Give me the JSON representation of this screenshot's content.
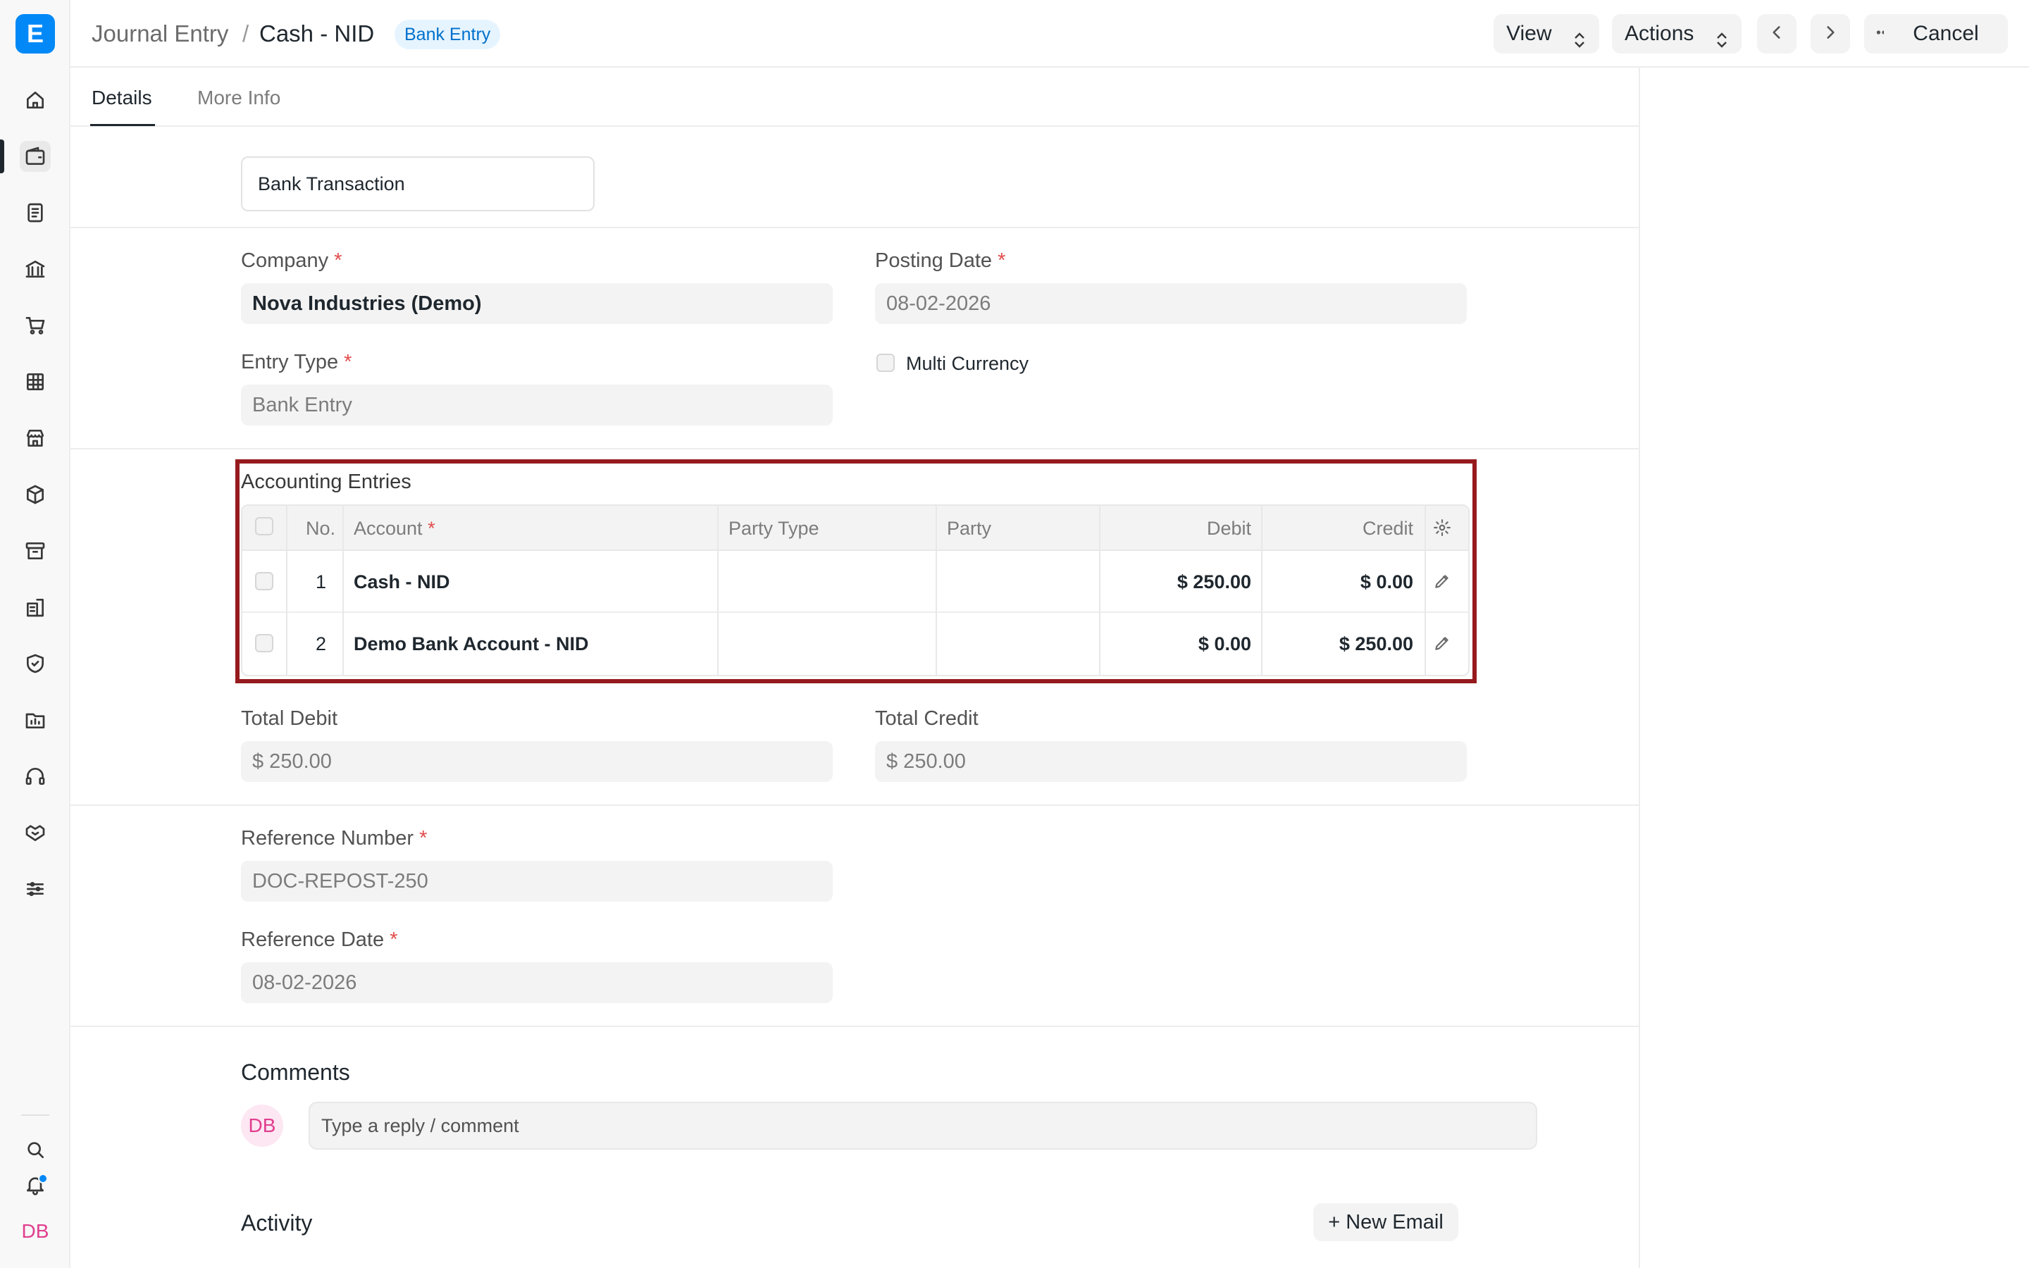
{
  "app": {
    "logo_letter": "E"
  },
  "sidebar": {
    "icons": [
      "home-icon",
      "wallet-icon",
      "document-icon",
      "bank-icon",
      "cart-icon",
      "table-icon",
      "store-icon",
      "box-icon",
      "archive-icon",
      "building-icon",
      "shield-icon",
      "folder-chart-icon",
      "headset-icon",
      "handshake-icon",
      "sliders-icon"
    ],
    "bottom_icons": [
      "search-icon",
      "bell-icon"
    ],
    "user_initials": "DB"
  },
  "header": {
    "breadcrumb_parent": "Journal Entry",
    "breadcrumb_sep": "/",
    "title": "Cash - NID",
    "status_badge": "Bank Entry",
    "view_label": "View",
    "actions_label": "Actions",
    "cancel_label": "Cancel"
  },
  "tabs": [
    {
      "label": "Details",
      "active": true
    },
    {
      "label": "More Info",
      "active": false
    }
  ],
  "form": {
    "voucher_type": "Bank Transaction",
    "company_label": "Company",
    "company_value": "Nova Industries (Demo)",
    "posting_date_label": "Posting Date",
    "posting_date_value": "08-02-2026",
    "entry_type_label": "Entry Type",
    "entry_type_value": "Bank Entry",
    "multi_currency_label": "Multi Currency",
    "required_mark": "*",
    "total_debit_label": "Total Debit",
    "total_debit_value": "$ 250.00",
    "total_credit_label": "Total Credit",
    "total_credit_value": "$ 250.00",
    "reference_number_label": "Reference Number",
    "reference_number_value": "DOC-REPOST-250",
    "reference_date_label": "Reference Date",
    "reference_date_value": "08-02-2026"
  },
  "accounting_entries": {
    "title": "Accounting Entries",
    "columns": [
      "No.",
      "Account",
      "Party Type",
      "Party",
      "Debit",
      "Credit"
    ],
    "rows": [
      {
        "no": "1",
        "account": "Cash - NID",
        "party_type": "",
        "party": "",
        "debit": "$ 250.00",
        "credit": "$ 0.00"
      },
      {
        "no": "2",
        "account": "Demo Bank Account - NID",
        "party_type": "",
        "party": "",
        "debit": "$ 0.00",
        "credit": "$ 250.00"
      }
    ]
  },
  "comments": {
    "heading": "Comments",
    "avatar_initials": "DB",
    "placeholder": "Type a reply / comment"
  },
  "activity": {
    "heading": "Activity",
    "new_email_label": "+ New Email"
  },
  "colors": {
    "accent": "#0289f7",
    "highlight_border": "#961a1e",
    "required": "#e24c4c",
    "badge_bg": "#e6f4ff",
    "badge_text": "#0070cc"
  }
}
